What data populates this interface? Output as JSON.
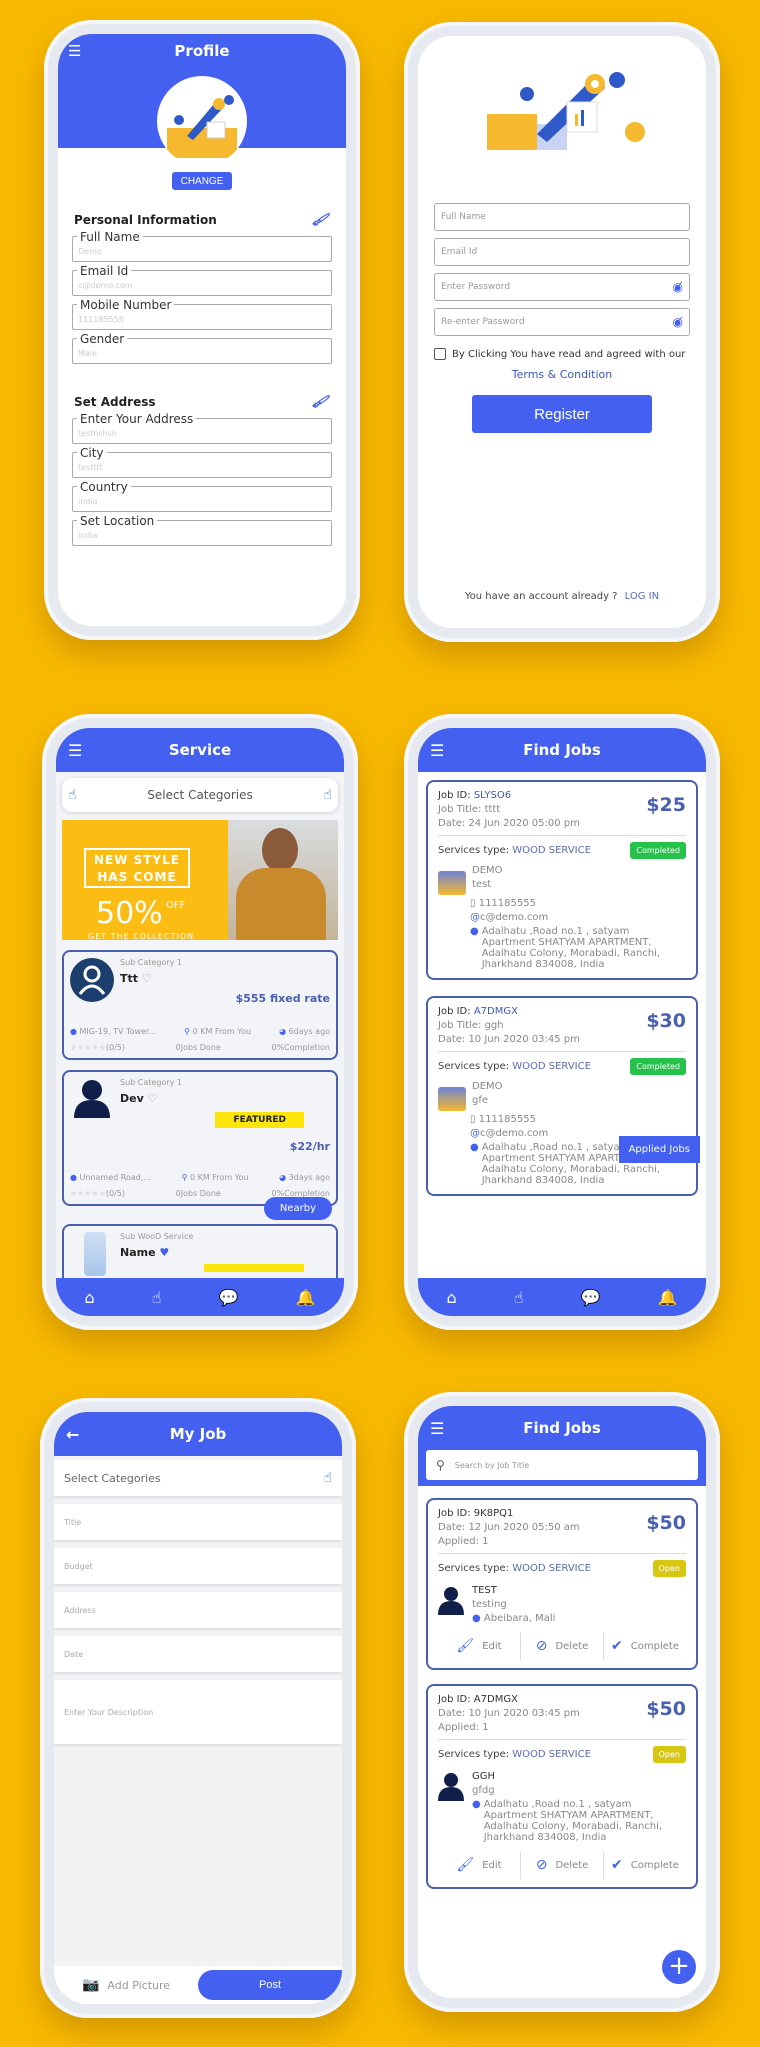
{
  "colors": {
    "background": "#f8b900",
    "primary": "#4360f0",
    "card_border": "#4a5fb0",
    "completed": "#27c24c",
    "open": "#d7c713",
    "featured": "#fce50a"
  },
  "profile": {
    "title": "Profile",
    "change_label": "CHANGE",
    "personal_heading": "Personal Information",
    "personal_fields": [
      {
        "label": "Full Name",
        "value": "Demo"
      },
      {
        "label": "Email Id",
        "value": "c@demo.com"
      },
      {
        "label": "Mobile Number",
        "value": "111185555"
      },
      {
        "label": "Gender",
        "value": "Male"
      }
    ],
    "address_heading": "Set Address",
    "address_fields": [
      {
        "label": "Enter Your Address",
        "value": "testhshsh"
      },
      {
        "label": "City",
        "value": "testttt"
      },
      {
        "label": "Country",
        "value": "india"
      },
      {
        "label": "Set Location",
        "value": "india"
      }
    ]
  },
  "register": {
    "full_name_placeholder": "Full Name",
    "email_placeholder": "Email Id",
    "password_placeholder": "Enter Password",
    "repassword_placeholder": "Re-enter Password",
    "agree_text": "By Clicking You have read and agreed with our",
    "terms_link": "Terms & Condition",
    "register_label": "Register",
    "have_account": "You have an account already ?",
    "login_link": "LOG IN"
  },
  "service": {
    "title": "Service",
    "select_categories": "Select Categories",
    "banner": {
      "line1": "NEW STYLE",
      "line2": "HAS COME",
      "percent": "50%",
      "off": "OFF",
      "cta": "GET THE COLLECTION"
    },
    "cards": [
      {
        "sub": "Sub Category 1",
        "name": "Ttt",
        "rate": "$555 fixed rate",
        "location": "MIG-19, TV Tower...",
        "distance": "0 KM From You",
        "time": "6days ago",
        "rating": "(0/5)",
        "jobs": "0Jobs Done",
        "completion": "0%Completion",
        "featured": false
      },
      {
        "sub": "Sub Category 1",
        "name": "Dev",
        "rate": "$22/hr",
        "location": "Unnamed Road,...",
        "distance": "0 KM From You",
        "time": "3days ago",
        "rating": "(0/5)",
        "jobs": "0Jobs Done",
        "completion": "0%Completion",
        "featured": true,
        "featured_label": "FEATURED"
      },
      {
        "sub": "Sub WooD Service",
        "name": "Name"
      }
    ],
    "nearby_label": "Nearby"
  },
  "find_jobs_1": {
    "title": "Find Jobs",
    "jobs": [
      {
        "id_label": "Job ID:",
        "id": "SLYSO6",
        "title": "Job Title: tttt",
        "date": "Date: 24 Jun 2020 05:00 pm",
        "price": "$25",
        "svc_label": "Services type:",
        "svc": "WOOD SERVICE",
        "status": "Completed",
        "name": "DEMO",
        "desc": "test",
        "phone": "111185555",
        "email": "c@demo.com",
        "address": "Adalhatu ,Road no.1 , satyam Apartment SHATYAM APARTMENT, Adalhatu Colony, Morabadi, Ranchi, Jharkhand 834008, India"
      },
      {
        "id_label": "Job ID:",
        "id": "A7DMGX",
        "title": "Job Title: ggh",
        "date": "Date: 10 Jun 2020 03:45 pm",
        "price": "$30",
        "svc_label": "Services type:",
        "svc": "WOOD SERVICE",
        "status": "Completed",
        "name": "DEMO",
        "desc": "gfe",
        "phone": "111185555",
        "email": "c@demo.com",
        "address": "Adalhatu ,Road no.1 , satyam Apartment SHATYAM APARTMENT, Adalhatu Colony, Morabadi, Ranchi, Jharkhand 834008, India"
      }
    ],
    "applied_label": "Applied Jobs"
  },
  "my_job": {
    "title": "My Job",
    "select_categories": "Select Categories",
    "title_placeholder": "Title",
    "budget_placeholder": "Budget",
    "address_placeholder": "Address",
    "date_placeholder": "Date",
    "description_placeholder": "Enter Your Description",
    "add_picture": "Add Picture",
    "post": "Post"
  },
  "find_jobs_2": {
    "title": "Find Jobs",
    "search_placeholder": "Search by Job Title",
    "jobs": [
      {
        "id": "Job ID: 9K8PQ1",
        "date": "Date: 12 Jun 2020 05:50 am",
        "applied": "Applied: 1",
        "price": "$50",
        "svc_label": "Services type:",
        "svc": "WOOD SERVICE",
        "status": "Open",
        "name": "TEST",
        "desc": "testing",
        "address": "Abeibara, Mali"
      },
      {
        "id": "Job ID: A7DMGX",
        "date": "Date: 10 Jun 2020 03:45 pm",
        "applied": "Applied: 1",
        "price": "$50",
        "svc_label": "Services type:",
        "svc": "WOOD SERVICE",
        "status": "Open",
        "name": "GGH",
        "desc": "gfdg",
        "address": "Adalhatu ,Road no.1 , satyam Apartment SHATYAM APARTMENT, Adalhatu Colony, Morabadi, Ranchi, Jharkhand 834008, India"
      }
    ],
    "edit": "Edit",
    "delete": "Delete",
    "complete": "Complete"
  }
}
